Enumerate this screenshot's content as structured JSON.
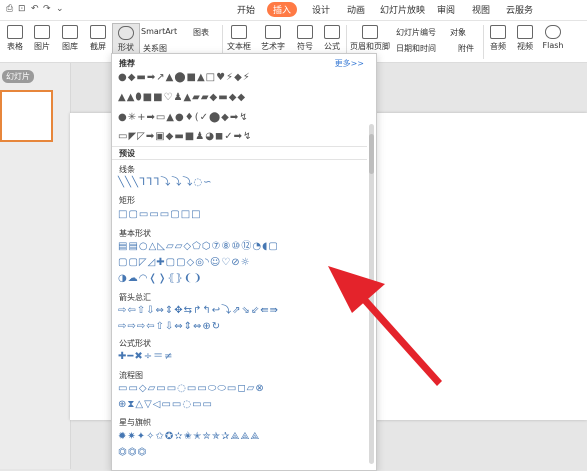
{
  "quick_access": {
    "icons": [
      "print-icon",
      "undo-icon",
      "redo-icon",
      "dropdown-icon"
    ]
  },
  "tabs": [
    "开始",
    "插入",
    "设计",
    "动画",
    "幻灯片放映",
    "审阅",
    "视图",
    "云服务"
  ],
  "active_tab": "插入",
  "ribbon": {
    "table": "表格",
    "picture": "图片",
    "gallery": "图库",
    "screenshot": "截屏",
    "shapes": "形状",
    "smartart": "SmartArt",
    "chart": "图表",
    "relation": "关系图",
    "textbox": "文本框",
    "wordart": "艺术字",
    "symbol": "符号",
    "formula": "公式",
    "header_footer": "页眉和页脚",
    "slide_number": "幻灯片编号",
    "object": "对象",
    "date_time": "日期和时间",
    "attachment": "附件",
    "audio": "音频",
    "video": "视频",
    "flash": "Flash"
  },
  "left_panel": {
    "label": "幻灯片",
    "thumb_number": "1"
  },
  "dropdown": {
    "recommended_title": "推荐",
    "more_label": "更多>>",
    "preset_title": "预设",
    "sections": [
      "线条",
      "矩形",
      "基本形状",
      "箭头总汇",
      "公式形状",
      "流程图",
      "星与旗帜"
    ],
    "rows": {
      "rec1": "●◆▬➡↗▲⬤■▲□♥⚡◆⚡",
      "rec2": "▲▲⬮■■♡♟▲▰▰◆▬◆◆",
      "rec3": "●✳+➡▭▲●♦(✓⬤◆➡↯",
      "rec4": "▭◤◸➡▣◆▬■♟◕◼✓➡↯",
      "lines": "╲╲╲ᒣᒣᒣ⤵⤵⤵◌∽",
      "rects": "□▢▭▭▭▢□□",
      "basic1": "▤▤○△◺▱▱◇⬠⬡⑦⑧⑩⑫◔◖▢",
      "basic2": "▢▢◸◿✚▢▢◇◎◝☺♡⊘☼",
      "basic3": "◑☁◠❬❭⦃⦄❨❩",
      "arrows1": "⇨⇦⇧⇩⇔⇕✥⇆↱↰↩⤵⇗⇘⇙⇚⇛",
      "arrows2": "⇨⇨⇨⇦⇧⇩⇔⇕⇔⊕↻",
      "formula": "✚━✖÷＝≠",
      "flow1": "▭▭◇▱▭▭◌▭▭⬭⬭▭◻▱⊗",
      "flow2": "⊕⧗△▽◁▭▭◌▭▭",
      "stars": "✹✷✦✧✩✪✫✬✭✮✯✰⟁⟁⟁",
      "stars2": "⏣⏣⏣"
    }
  }
}
